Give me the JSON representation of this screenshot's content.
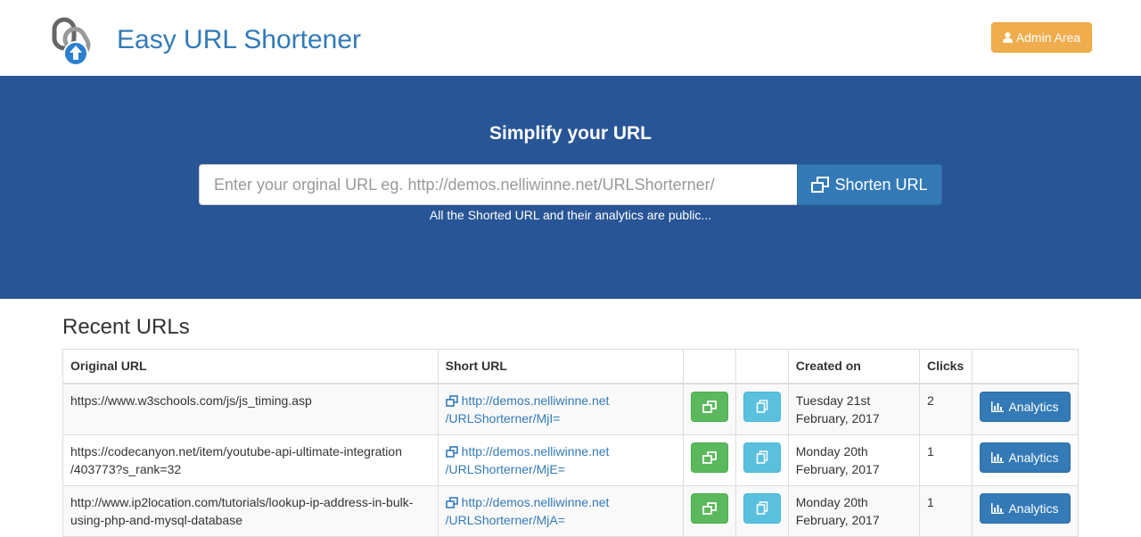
{
  "header": {
    "brand": "Easy URL Shortener",
    "admin_label": "Admin Area"
  },
  "hero": {
    "title": "Simplify your URL",
    "input_placeholder": "Enter your orginal URL eg. http://demos.nelliwinne.net/URLShorterner/",
    "shorten_label": "Shorten URL",
    "note": "All the Shorted URL and their analytics are public..."
  },
  "recent": {
    "title": "Recent URLs",
    "columns": [
      "Original URL",
      "Short URL",
      "",
      "",
      "Created on",
      "Clicks",
      ""
    ],
    "analytics_label": "Analytics",
    "rows": [
      {
        "original": "https://www.w3schools.com/js/js_timing.asp",
        "short_line1": "http://demos.nelliwinne.net",
        "short_line2": "/URLShorterner/MjI=",
        "created_line1": "Tuesday 21st",
        "created_line2": "February, 2017",
        "clicks": "2"
      },
      {
        "original": "https://codecanyon.net/item/youtube-api-ultimate-integration /403773?s_rank=32",
        "short_line1": "http://demos.nelliwinne.net",
        "short_line2": "/URLShorterner/MjE=",
        "created_line1": "Monday 20th",
        "created_line2": "February, 2017",
        "clicks": "1"
      },
      {
        "original": "http://www.ip2location.com/tutorials/lookup-ip-address-in-bulk- using-php-and-mysql-database",
        "short_line1": "http://demos.nelliwinne.net",
        "short_line2": "/URLShorterner/MjA=",
        "created_line1": "Monday 20th",
        "created_line2": "February, 2017",
        "clicks": "1"
      }
    ]
  },
  "colors": {
    "hero_bg": "#285596",
    "brand": "#337ab7",
    "admin_btn": "#f0ad4e",
    "open_btn": "#5cb85c",
    "copy_btn": "#5bc0de"
  }
}
